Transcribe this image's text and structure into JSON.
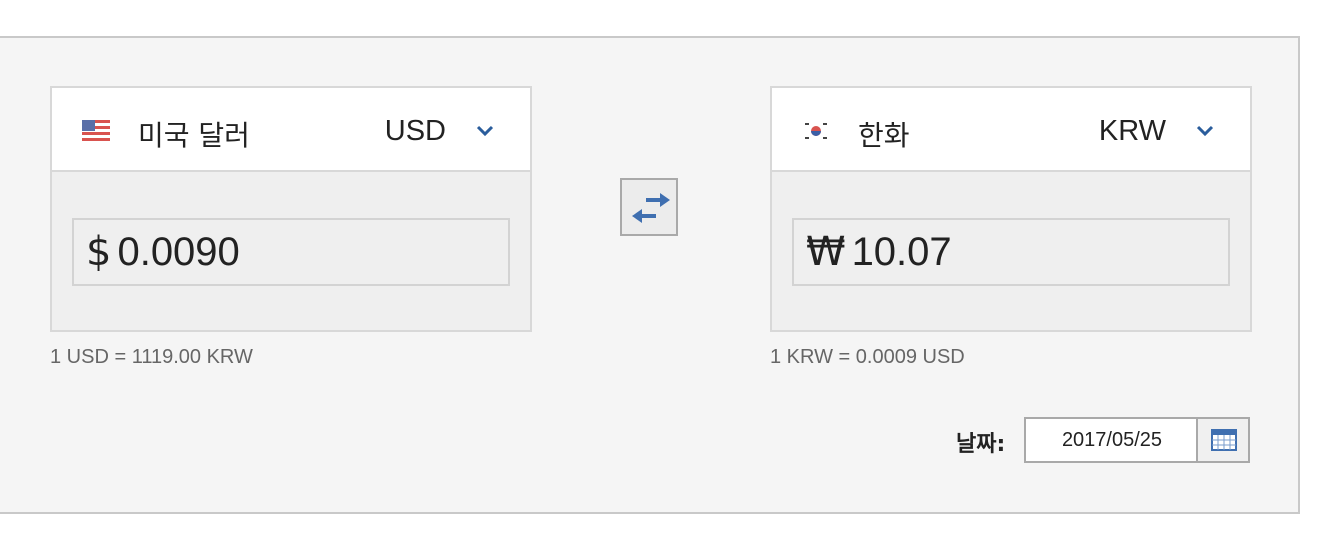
{
  "from": {
    "flag_icon": "us-flag-icon",
    "currency_name": "미국 달러",
    "currency_code": "USD",
    "symbol": "$",
    "amount": "0.0090",
    "rate_text": "1 USD = 1119.00 KRW"
  },
  "to": {
    "flag_icon": "kr-flag-icon",
    "currency_name": "한화",
    "currency_code": "KRW",
    "symbol": "₩",
    "amount": "10.07",
    "rate_text": "1 KRW = 0.0009 USD"
  },
  "swap_icon": "swap-arrows-icon",
  "date": {
    "label": "날짜:",
    "value": "2017/05/25",
    "calendar_icon": "calendar-icon"
  },
  "colors": {
    "accent": "#2a5d9c",
    "panel_bg": "#f5f5f5",
    "box_bg": "#efefef"
  }
}
